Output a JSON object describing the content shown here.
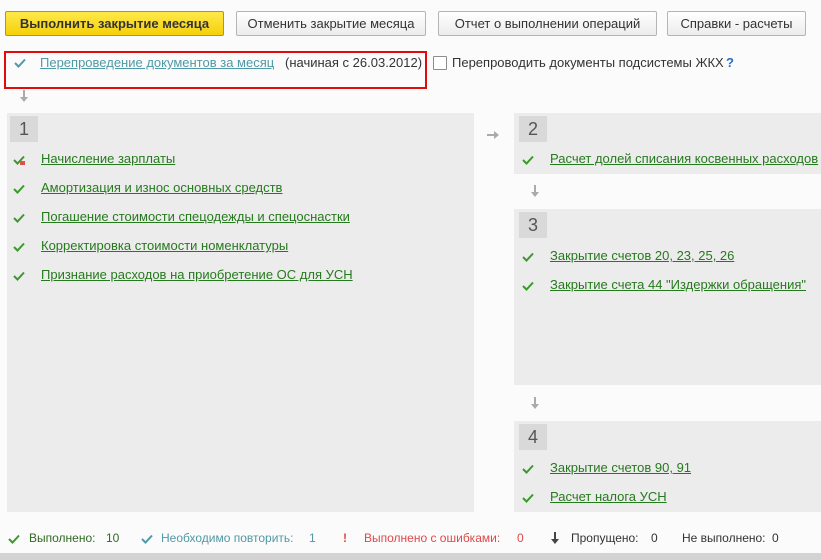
{
  "toolbar": {
    "execute": "Выполнить закрытие месяца",
    "cancel": "Отменить закрытие месяца",
    "report": "Отчет о выполнении операций",
    "calc": "Справки - расчеты"
  },
  "repost": {
    "link": "Перепроведение документов за месяц",
    "note": "(начиная с 26.03.2012)",
    "checkbox_label": "Перепроводить документы подсистемы ЖКХ",
    "help": "?"
  },
  "steps": [
    {
      "number": "1",
      "items": [
        "Начисление зарплаты",
        "Амортизация и износ основных средств",
        "Погашение стоимости спецодежды и спецоснастки",
        "Корректировка стоимости номенклатуры",
        "Признание расходов на приобретение ОС для УСН"
      ]
    },
    {
      "number": "2",
      "items": [
        "Расчет долей списания косвенных расходов"
      ]
    },
    {
      "number": "3",
      "items": [
        "Закрытие счетов 20, 23, 25, 26",
        "Закрытие счета 44 \"Издержки обращения\""
      ]
    },
    {
      "number": "4",
      "items": [
        "Закрытие счетов 90, 91",
        "Расчет налога УСН"
      ]
    }
  ],
  "status": {
    "done_label": "Выполнено:",
    "done_count": "10",
    "repeat_label": "Необходимо повторить:",
    "repeat_count": "1",
    "errors_label": "Выполнено с ошибками:",
    "errors_count": "0",
    "skipped_label": "Пропущено:",
    "skipped_count": "0",
    "notdone_label": "Не выполнено:",
    "notdone_count": "0"
  },
  "colors": {
    "success": "#3a9a2a",
    "repeat": "#4f9aa6",
    "error": "#e04848",
    "highlight": "#e20b0b",
    "primary_button": "#f5d00a"
  }
}
